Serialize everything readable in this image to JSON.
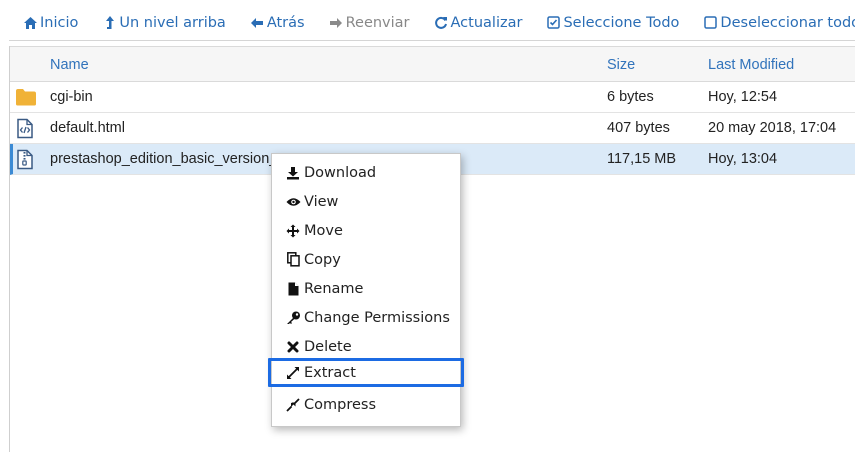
{
  "toolbar": {
    "home": "Inicio",
    "up": "Un nivel arriba",
    "back": "Atrás",
    "forward": "Reenviar",
    "reload": "Actualizar",
    "select_all": "Seleccione Todo",
    "deselect_all": "Deseleccionar todo"
  },
  "table": {
    "headers": {
      "name": "Name",
      "size": "Size",
      "modified": "Last Modified"
    },
    "rows": [
      {
        "icon": "folder-icon",
        "name": "cgi-bin",
        "size": "6 bytes",
        "modified": "Hoy, 12:54"
      },
      {
        "icon": "html-file-icon",
        "name": "default.html",
        "size": "407 bytes",
        "modified": "20 may 2018, 17:04"
      },
      {
        "icon": "zip-file-icon",
        "name": "prestashop_edition_basic_version_",
        "size": "117,15 MB",
        "modified": "Hoy, 13:04",
        "selected": true
      }
    ]
  },
  "context_menu": {
    "items": [
      {
        "label": "Download",
        "icon": "download-icon"
      },
      {
        "label": "View",
        "icon": "eye-icon"
      },
      {
        "label": "Move",
        "icon": "move-arrows-icon"
      },
      {
        "label": "Copy",
        "icon": "copy-icon"
      },
      {
        "label": "Rename",
        "icon": "file-icon"
      },
      {
        "label": "Change Permissions",
        "icon": "key-icon"
      },
      {
        "label": "Delete",
        "icon": "x-icon"
      },
      {
        "label": "Extract",
        "icon": "expand-icon",
        "highlighted": true
      },
      {
        "label": "Compress",
        "icon": "compress-icon"
      }
    ]
  },
  "colors": {
    "link_blue": "#2a6db5",
    "selected_row": "#dbeaf8",
    "highlight_border": "#1c6be3",
    "folder": "#f0b237"
  }
}
